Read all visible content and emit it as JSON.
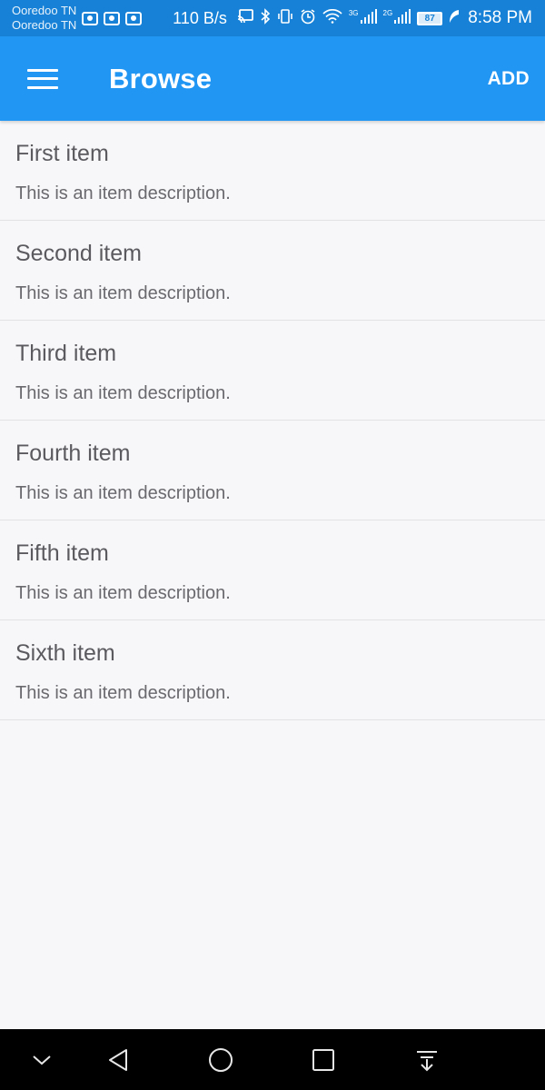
{
  "status_bar": {
    "carrier_1": "Ooredoo TN",
    "carrier_2": "Ooredoo TN",
    "net_speed": "110 B/s",
    "net_type_1": "3G",
    "net_type_2": "2G",
    "battery_level": "87",
    "time": "8:58 PM",
    "icons": [
      "video-icon",
      "camera-icon",
      "mail-icon",
      "cast-icon",
      "bluetooth-icon",
      "vibrate-icon",
      "alarm-icon",
      "wifi-icon",
      "signal-icon",
      "signal-icon",
      "battery-icon",
      "charging-icon"
    ]
  },
  "app_bar": {
    "title": "Browse",
    "add_label": "ADD",
    "background": "#2196f3"
  },
  "items": [
    {
      "title": "First item",
      "description": "This is an item description."
    },
    {
      "title": "Second item",
      "description": "This is an item description."
    },
    {
      "title": "Third item",
      "description": "This is an item description."
    },
    {
      "title": "Fourth item",
      "description": "This is an item description."
    },
    {
      "title": "Fifth item",
      "description": "This is an item description."
    },
    {
      "title": "Sixth item",
      "description": "This is an item description."
    }
  ],
  "nav_bar": {
    "icons": [
      "chevron-down-icon",
      "back-icon",
      "home-icon",
      "recents-icon",
      "notification-pull-icon"
    ]
  }
}
